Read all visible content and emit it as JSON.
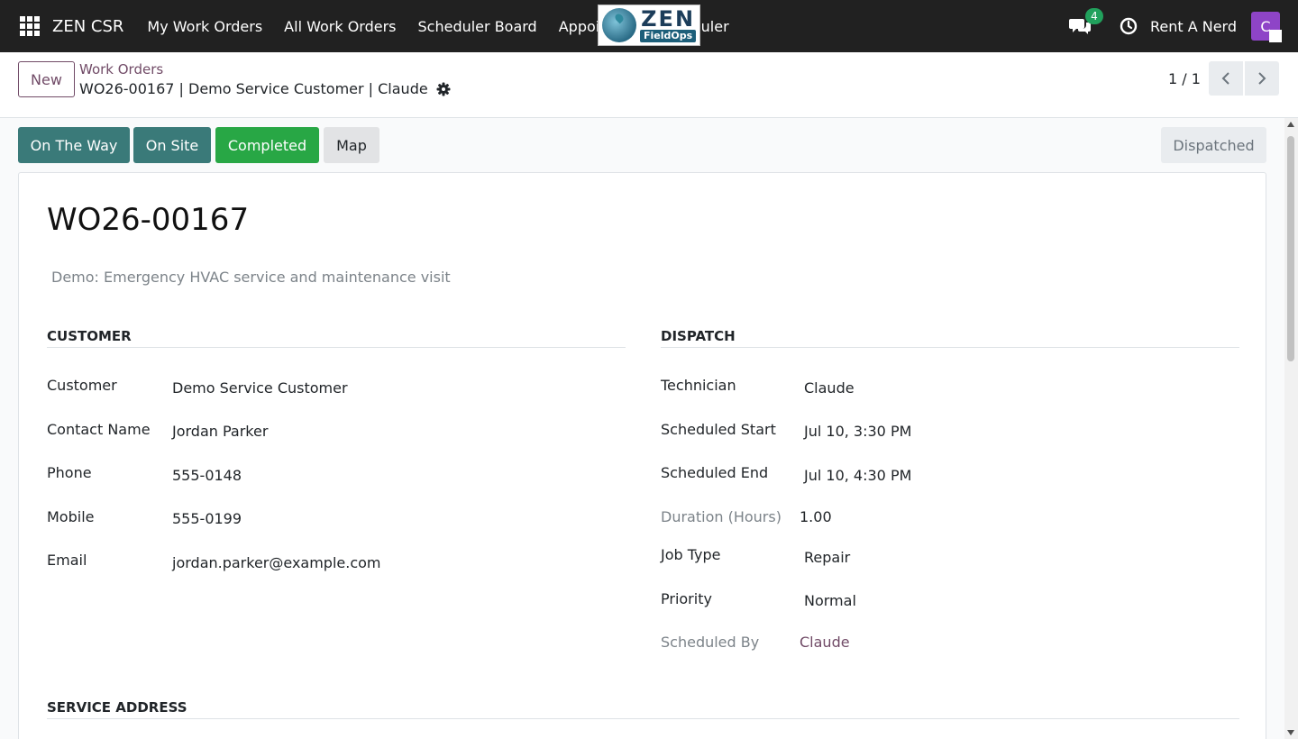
{
  "navbar": {
    "brand": "ZEN CSR",
    "menu": [
      "My Work Orders",
      "All Work Orders",
      "Scheduler Board",
      "Appointment Scheduler"
    ],
    "logo_title": "ZEN",
    "logo_subtitle": "FieldOps",
    "messages_count": "4",
    "company": "Rent A Nerd",
    "avatar_letter": "C"
  },
  "control_panel": {
    "new_label": "New",
    "breadcrumb_parent": "Work Orders",
    "breadcrumb_current": "WO26-00167 | Demo Service Customer | Claude",
    "pager": "1 / 1"
  },
  "status_bar": {
    "buttons": [
      "On The Way",
      "On Site",
      "Completed",
      "Map"
    ],
    "state": "Dispatched"
  },
  "form": {
    "title": "WO26-00167",
    "description": "Demo: Emergency HVAC service and maintenance visit",
    "customer_section": {
      "heading": "CUSTOMER",
      "fields": [
        {
          "label": "Customer",
          "value": "Demo Service Customer"
        },
        {
          "label": "Contact Name",
          "value": "Jordan Parker"
        },
        {
          "label": "Phone",
          "value": "555-0148"
        },
        {
          "label": "Mobile",
          "value": "555-0199"
        },
        {
          "label": "Email",
          "value": "jordan.parker@example.com"
        }
      ]
    },
    "dispatch_section": {
      "heading": "DISPATCH",
      "fields": [
        {
          "label": "Technician",
          "value": "Claude"
        },
        {
          "label": "Scheduled Start",
          "value": "Jul 10, 3:30 PM"
        },
        {
          "label": "Scheduled End",
          "value": "Jul 10, 4:30 PM"
        },
        {
          "label": "Duration (Hours)",
          "value": "1.00"
        },
        {
          "label": "Job Type",
          "value": "Repair"
        },
        {
          "label": "Priority",
          "value": "Normal"
        },
        {
          "label": "Scheduled By",
          "value": "Claude"
        }
      ]
    },
    "service_address_heading": "SERVICE ADDRESS"
  },
  "colors": {
    "navbar_bg": "#212121",
    "primary": "#714b67",
    "teal_button": "#3a7a79",
    "success_button": "#28a745",
    "badge": "#21a15c",
    "avatar": "#8e44c7"
  }
}
